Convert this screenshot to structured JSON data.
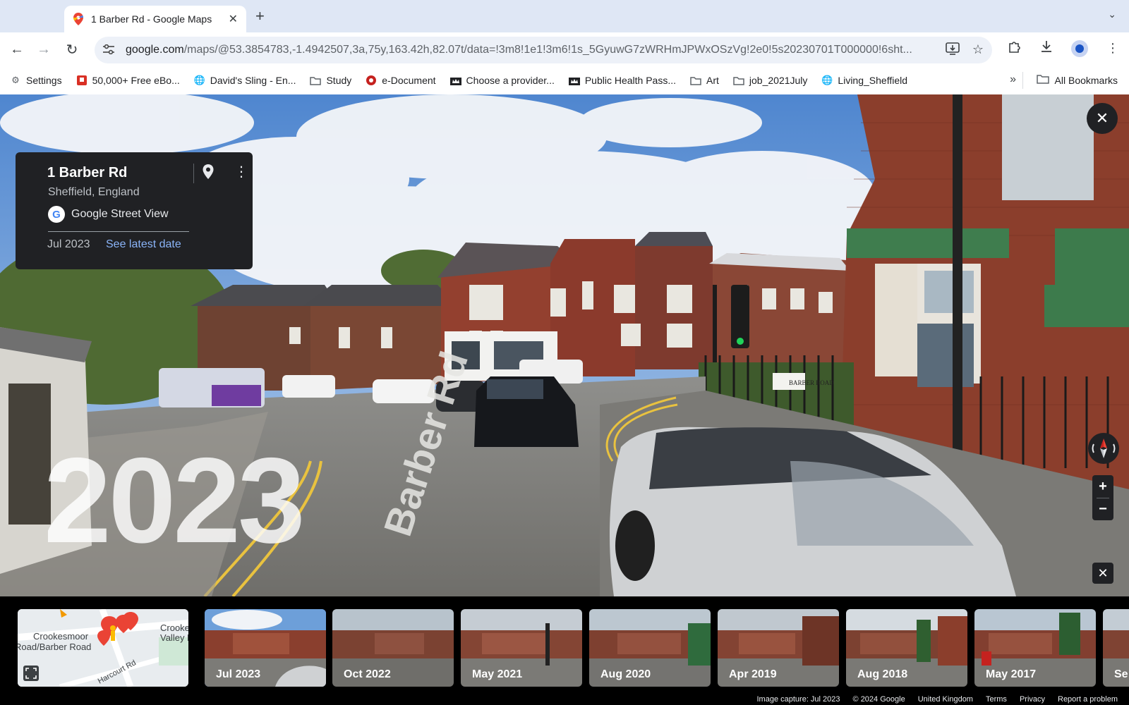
{
  "browser": {
    "tab_title": "1 Barber Rd - Google Maps",
    "url_host": "google.com",
    "url_path": "/maps/@53.3854783,-1.4942507,3a,75y,163.42h,82.07t/data=!3m8!1e1!3m6!1s_5GyuwG7zWRHmJPWxOSzVg!2e0!5s20230701T000000!6sht..."
  },
  "bookmarks": {
    "items": [
      {
        "label": "Settings",
        "icon": "gear-icon"
      },
      {
        "label": "50,000+ Free eBo...",
        "icon": "book-icon"
      },
      {
        "label": "David's Sling - En...",
        "icon": "globe-icon"
      },
      {
        "label": "Study",
        "icon": "folder-icon"
      },
      {
        "label": "e-Document",
        "icon": "document-icon"
      },
      {
        "label": "Choose a provider...",
        "icon": "crown-icon"
      },
      {
        "label": "Public Health Pass...",
        "icon": "crown-icon"
      },
      {
        "label": "Art",
        "icon": "folder-icon"
      },
      {
        "label": "job_2021July",
        "icon": "folder-icon"
      },
      {
        "label": "Living_Sheffield",
        "icon": "globe-icon"
      }
    ],
    "all_label": "All Bookmarks"
  },
  "streetview": {
    "year_watermark": "2023",
    "road_label": "Barber Rd",
    "sign_label": "BARBER ROAD",
    "info": {
      "place": "1 Barber Rd",
      "city": "Sheffield, England",
      "source": "Google Street View",
      "date": "Jul 2023",
      "latest_link": "See latest date"
    }
  },
  "minimap": {
    "labels": [
      "Crookesmoor",
      "Road/Barber Road",
      "Crookes",
      "Valley Roa",
      "Harcourt Rd"
    ]
  },
  "timeline": [
    {
      "label": "Jul 2023",
      "active": true
    },
    {
      "label": "Oct 2022",
      "active": false
    },
    {
      "label": "May 2021",
      "active": false
    },
    {
      "label": "Aug 2020",
      "active": false
    },
    {
      "label": "Apr 2019",
      "active": false
    },
    {
      "label": "Aug 2018",
      "active": false
    },
    {
      "label": "May 2017",
      "active": false
    },
    {
      "label": "Se",
      "active": false
    }
  ],
  "footer": {
    "capture": "Image capture: Jul 2023",
    "copyright": "© 2024 Google",
    "region": "United Kingdom",
    "terms": "Terms",
    "privacy": "Privacy",
    "report": "Report a problem"
  }
}
